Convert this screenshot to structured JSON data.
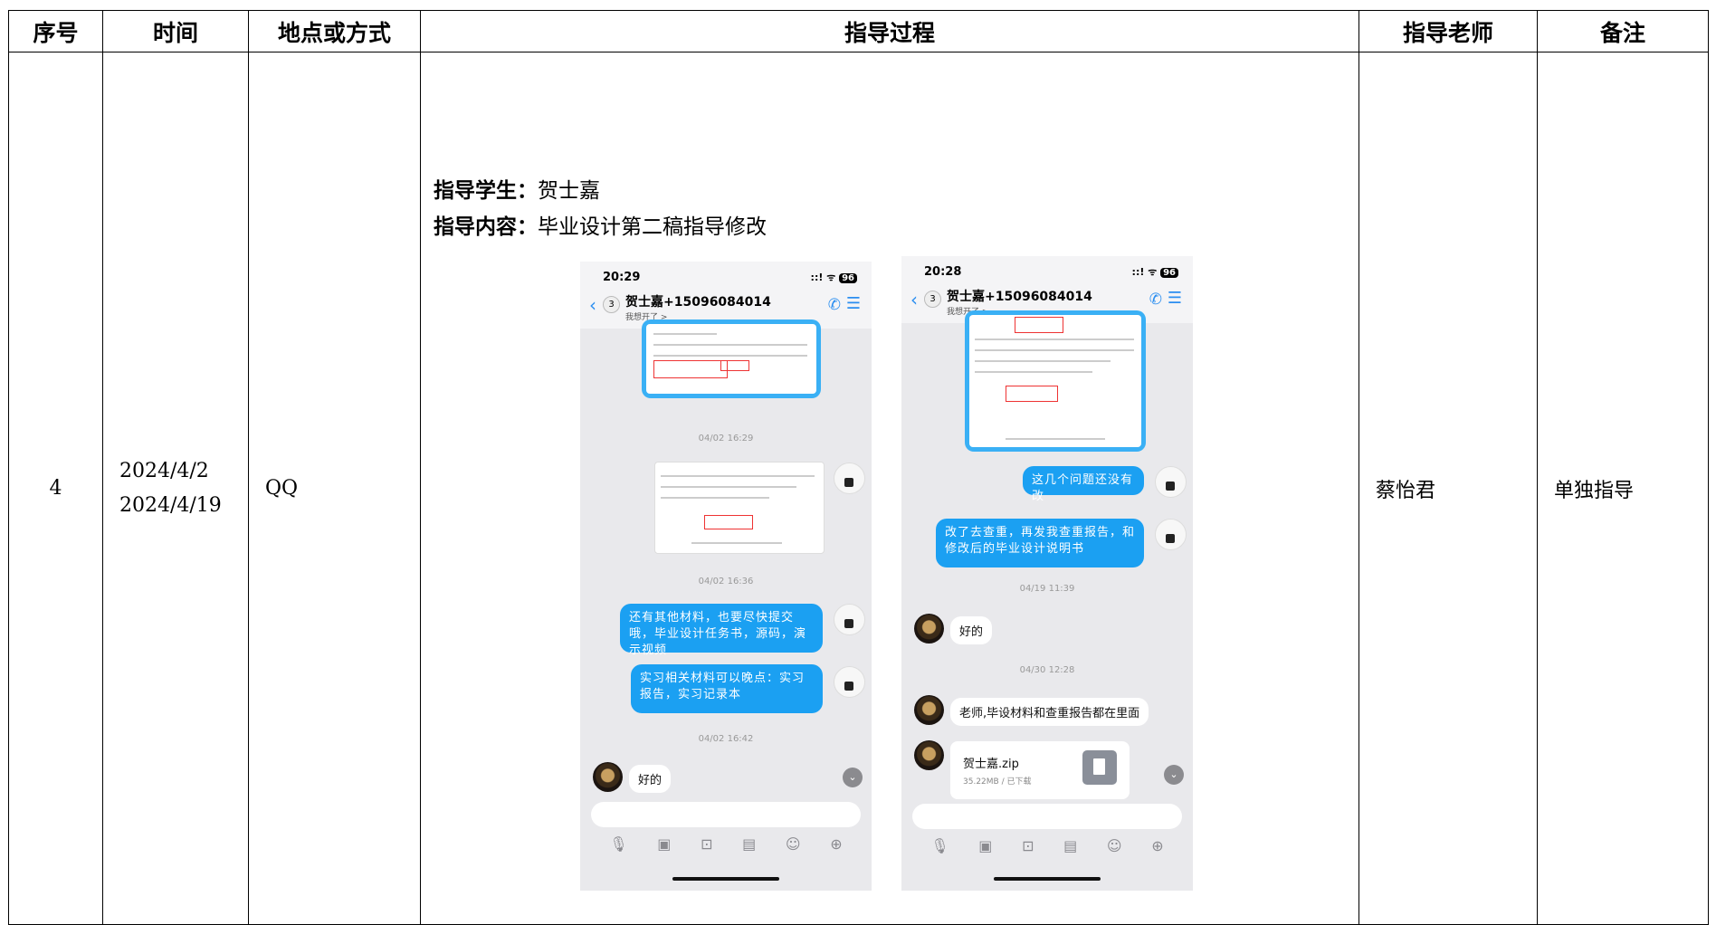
{
  "table": {
    "headers": [
      "序号",
      "时间",
      "地点或方式",
      "指导过程",
      "指导老师",
      "备注"
    ],
    "row": {
      "index": "4",
      "dates": [
        "2024/4/2",
        "2024/4/19"
      ],
      "method": "QQ",
      "teacher": "蔡怡君",
      "remark": "单独指导"
    }
  },
  "guidance": {
    "student_label": "指导学生：",
    "student_name": "贺士嘉",
    "content_label": "指导内容：",
    "content_text": "毕业设计第二稿指导修改"
  },
  "phone1": {
    "time": "20:29",
    "status": "::! ᯤ",
    "battery": "96",
    "badge": "3",
    "contact": "贺士嘉+15096084014",
    "subtitle": "我想开了 >",
    "ts1": "04/02 16:29",
    "ts2": "04/02 16:36",
    "msg1": "还有其他材料，也要尽快提交哦，毕业设计任务书，源码，演示视频",
    "msg2": "实习相关材料可以晚点：实习报告，实习记录本",
    "ts3": "04/02 16:42",
    "reply": "好的"
  },
  "phone2": {
    "time": "20:28",
    "status": "::! ᯤ",
    "battery": "96",
    "badge": "3",
    "contact": "贺士嘉+15096084014",
    "subtitle": "我想开了 >",
    "msg1": "这几个问题还没有改",
    "msg2": "改了去查重，再发我查重报告，和修改后的毕业设计说明书",
    "ts1": "04/19 11:39",
    "reply1": "好的",
    "ts2": "04/30 12:28",
    "reply2": "老师,毕设材料和查重报告都在里面",
    "file_name": "贺士嘉.zip",
    "file_size": "35.22MB / 已下载"
  },
  "icons": [
    "mic-icon",
    "image-icon",
    "camera-icon",
    "file-icon",
    "emoji-icon",
    "plus-icon"
  ]
}
